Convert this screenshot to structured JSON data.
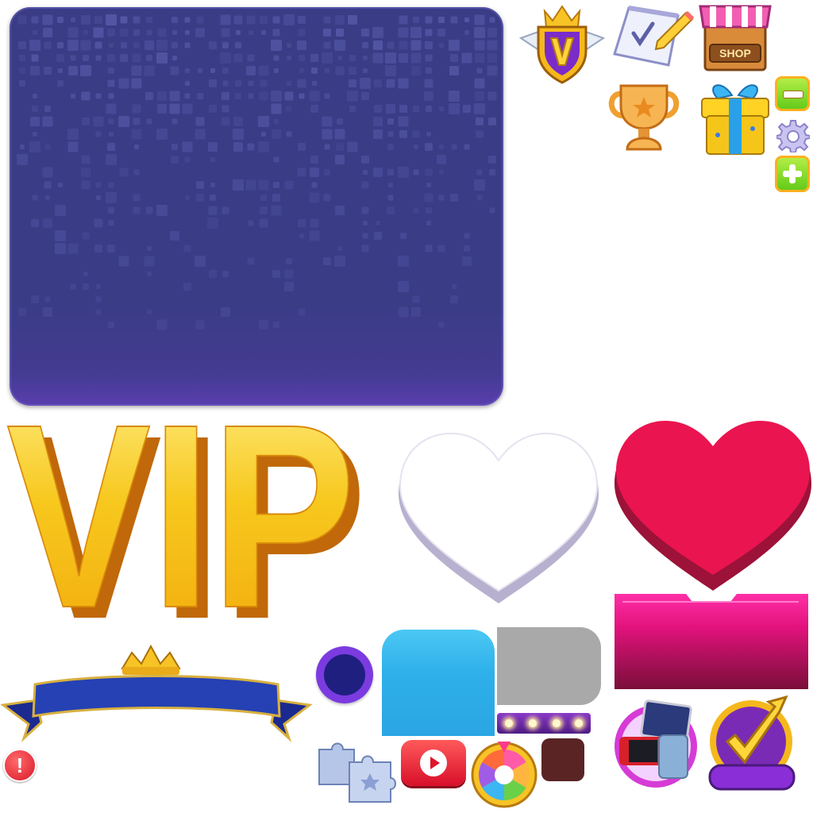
{
  "vip_text": "VIP",
  "shop_sign": "SHOP",
  "alert_symbol": "!",
  "colors": {
    "panel": "#3a3c86",
    "gold": "#f5c21b",
    "heart_red": "#e8114a",
    "magenta": "#e0127a",
    "blue_tab": "#2eb0ea",
    "grey_tab": "#a9a9a9",
    "ribbon_blue": "#1f3aa8"
  },
  "icons": [
    "vip-shield-icon",
    "task-clipboard-icon",
    "shop-stall-icon",
    "trophy-icon",
    "gift-box-icon",
    "minus-icon",
    "gear-icon",
    "plus-icon",
    "alert-icon",
    "youtube-play-icon",
    "lucky-wheel-icon",
    "puzzle-pieces-icon",
    "prize-devices-icon",
    "checkmark-arrow-icon"
  ]
}
